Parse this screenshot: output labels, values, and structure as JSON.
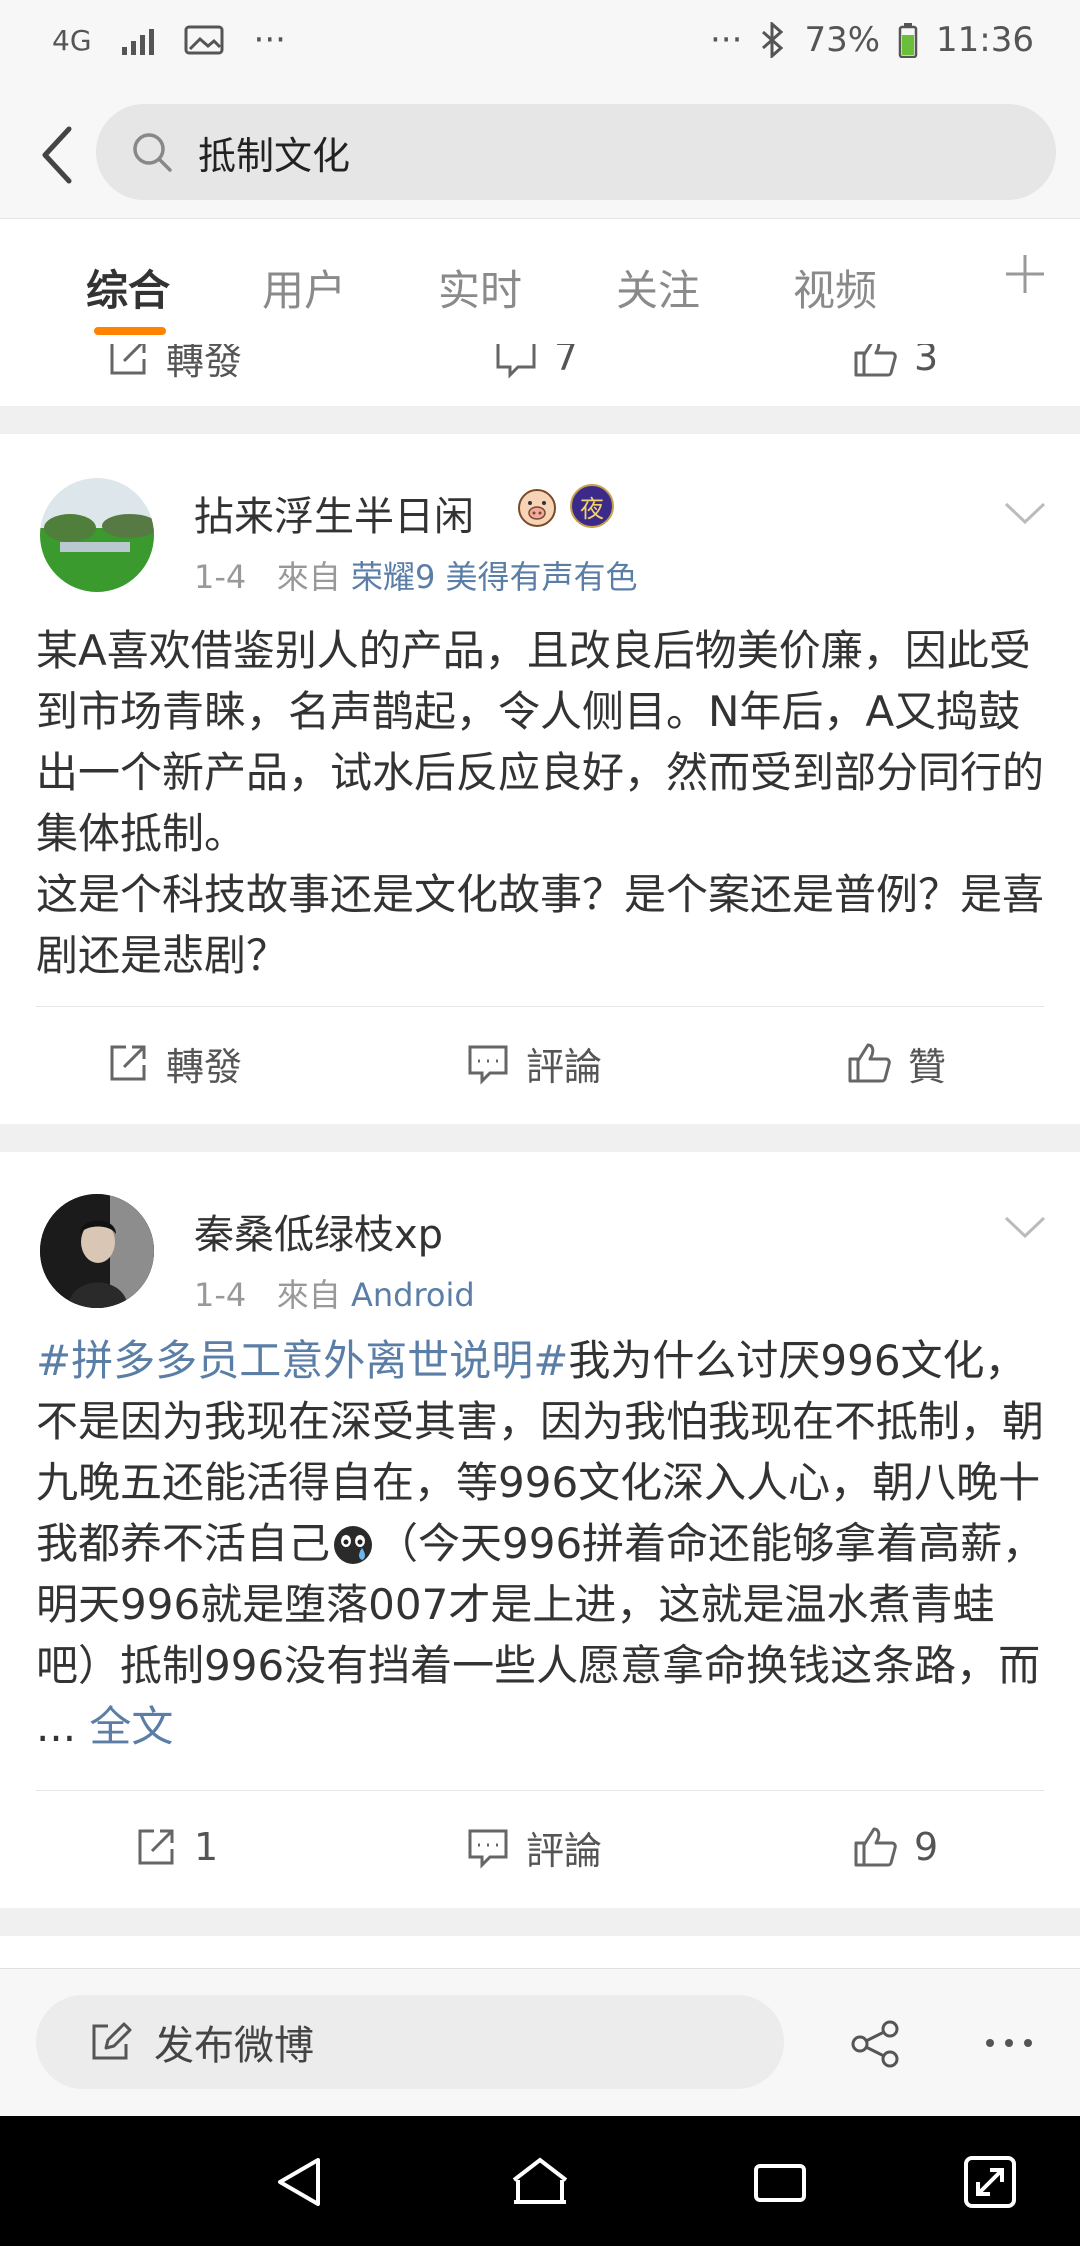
{
  "status_bar": {
    "network": "4G",
    "more": "···",
    "more_right": "···",
    "battery": "73%",
    "time": "11:36"
  },
  "search": {
    "query": "抵制文化"
  },
  "tabs": [
    {
      "label": "综合"
    },
    {
      "label": "用户"
    },
    {
      "label": "实时"
    },
    {
      "label": "关注"
    },
    {
      "label": "视频"
    }
  ],
  "previous_post_actions": {
    "repost": "轉發",
    "comment_count": "7",
    "like_count": "3"
  },
  "posts": [
    {
      "username": "拈来浮生半日闲",
      "badge": "夜",
      "date": "1-4",
      "from_label": "來自",
      "source": "荣耀9 美得有声有色",
      "text": "某A喜欢借鉴别人的产品，且改良后物美价廉，因此受到市场青睐，名声鹊起，令人侧目。N年后，A又捣鼓出一个新产品，试水后反应良好，然而受到部分同行的集体抵制。\n这是个科技故事还是文化故事？是个案还是普例？是喜剧还是悲剧？",
      "repost_label": "轉發",
      "comment_label": "評論",
      "like_label": "贊"
    },
    {
      "username": "秦桑低绿枝xp",
      "date": "1-4",
      "from_label": "來自",
      "source": "Android",
      "hashtag": "#拼多多员工意外离世说明#",
      "text": "我为什么讨厌996文化，不是因为我现在深受其害，因为我怕我现在不抵制，朝九晚五还能活得自在，等996文化深入人心，朝八晚十我都养不活自己",
      "text_after_emoji": "（今天996拼着命还能够拿着高薪，明天996就是堕落007才是上进，这就是温水煮青蛙吧）抵制996没有挡着一些人愿意拿命换钱这条路，而 ... ",
      "more_label": "全文",
      "repost_count": "1",
      "comment_label": "評論",
      "like_count": "9"
    }
  ],
  "compose": {
    "label": "发布微博"
  },
  "colors": {
    "accent": "#ff8200",
    "link": "#5b7ea7",
    "text": "#333333",
    "muted": "#999999"
  }
}
